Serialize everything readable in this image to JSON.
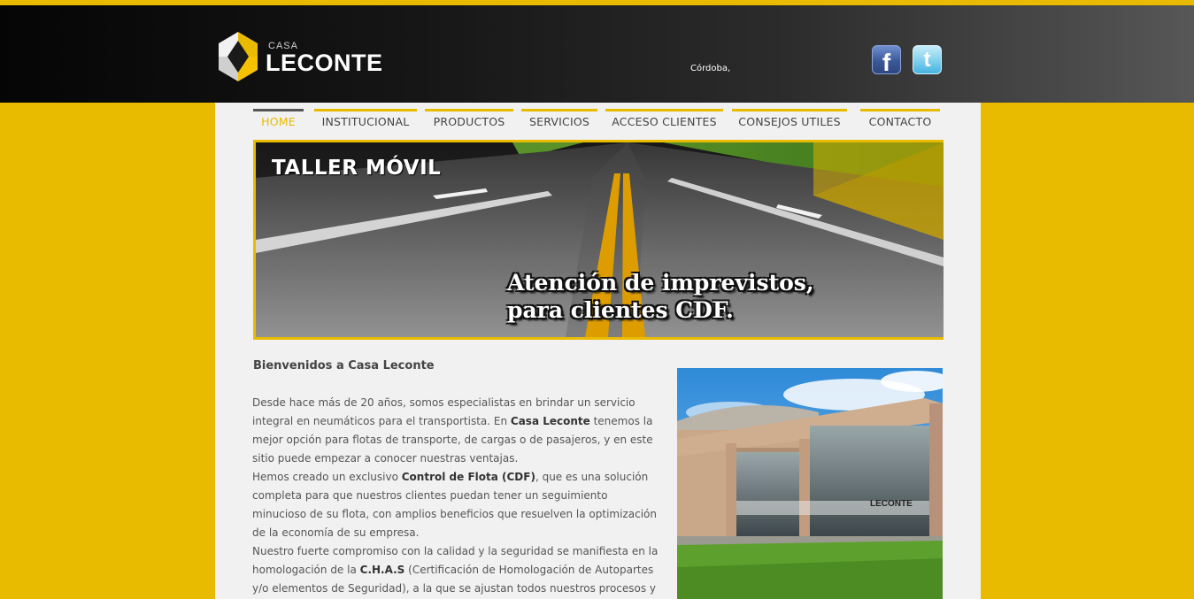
{
  "header": {
    "logo": {
      "casa": "CASA",
      "name": "LECONTE"
    },
    "city": "Córdoba,",
    "social": {
      "facebook": "f",
      "twitter": "t"
    }
  },
  "nav": {
    "items": [
      {
        "label": "HOME",
        "active": true
      },
      {
        "label": "INSTITUCIONAL",
        "active": false
      },
      {
        "label": "PRODUCTOS",
        "active": false
      },
      {
        "label": "SERVICIOS",
        "active": false
      },
      {
        "label": "ACCESO CLIENTES",
        "active": false
      },
      {
        "label": "CONSEJOS UTILES",
        "active": false
      },
      {
        "label": "CONTACTO",
        "active": false
      }
    ]
  },
  "banner": {
    "title": "TALLER MÓVIL",
    "caption_line1": "Atención de imprevistos,",
    "caption_line2": "para clientes CDF."
  },
  "main": {
    "welcome": "Bienvenidos a Casa Leconte",
    "p1_a": "Desde hace más de 20 años, somos especialistas en brindar un servicio integral en neumáticos para el transportista. En ",
    "p1_bold": "Casa Leconte",
    "p1_b": " tenemos la mejor opción para flotas de transporte, de cargas o de pasajeros, y en este sitio puede empezar a conocer nuestras ventajas.",
    "p2_a": "Hemos creado un exclusivo ",
    "p2_bold": "Control de Flota (CDF)",
    "p2_b": ", que es una solución completa para que nuestros clientes puedan tener un seguimiento minucioso de su flota, con amplios beneficios que resuelven la optimización de la economía de su empresa.",
    "p3_a": "Nuestro fuerte compromiso con la calidad y la seguridad se manifiesta en la homologación de la ",
    "p3_bold": "C.H.A.S",
    "p3_b": " (Certificación de Homologación de Autopartes y/o elementos de Seguridad), a la que se ajustan todos nuestros procesos y estamos",
    "photo_sign": "LECONTE"
  },
  "colors": {
    "accent": "#e9bb00",
    "header_dark": "#0a0a0a",
    "content_bg": "#f1f1f1"
  }
}
